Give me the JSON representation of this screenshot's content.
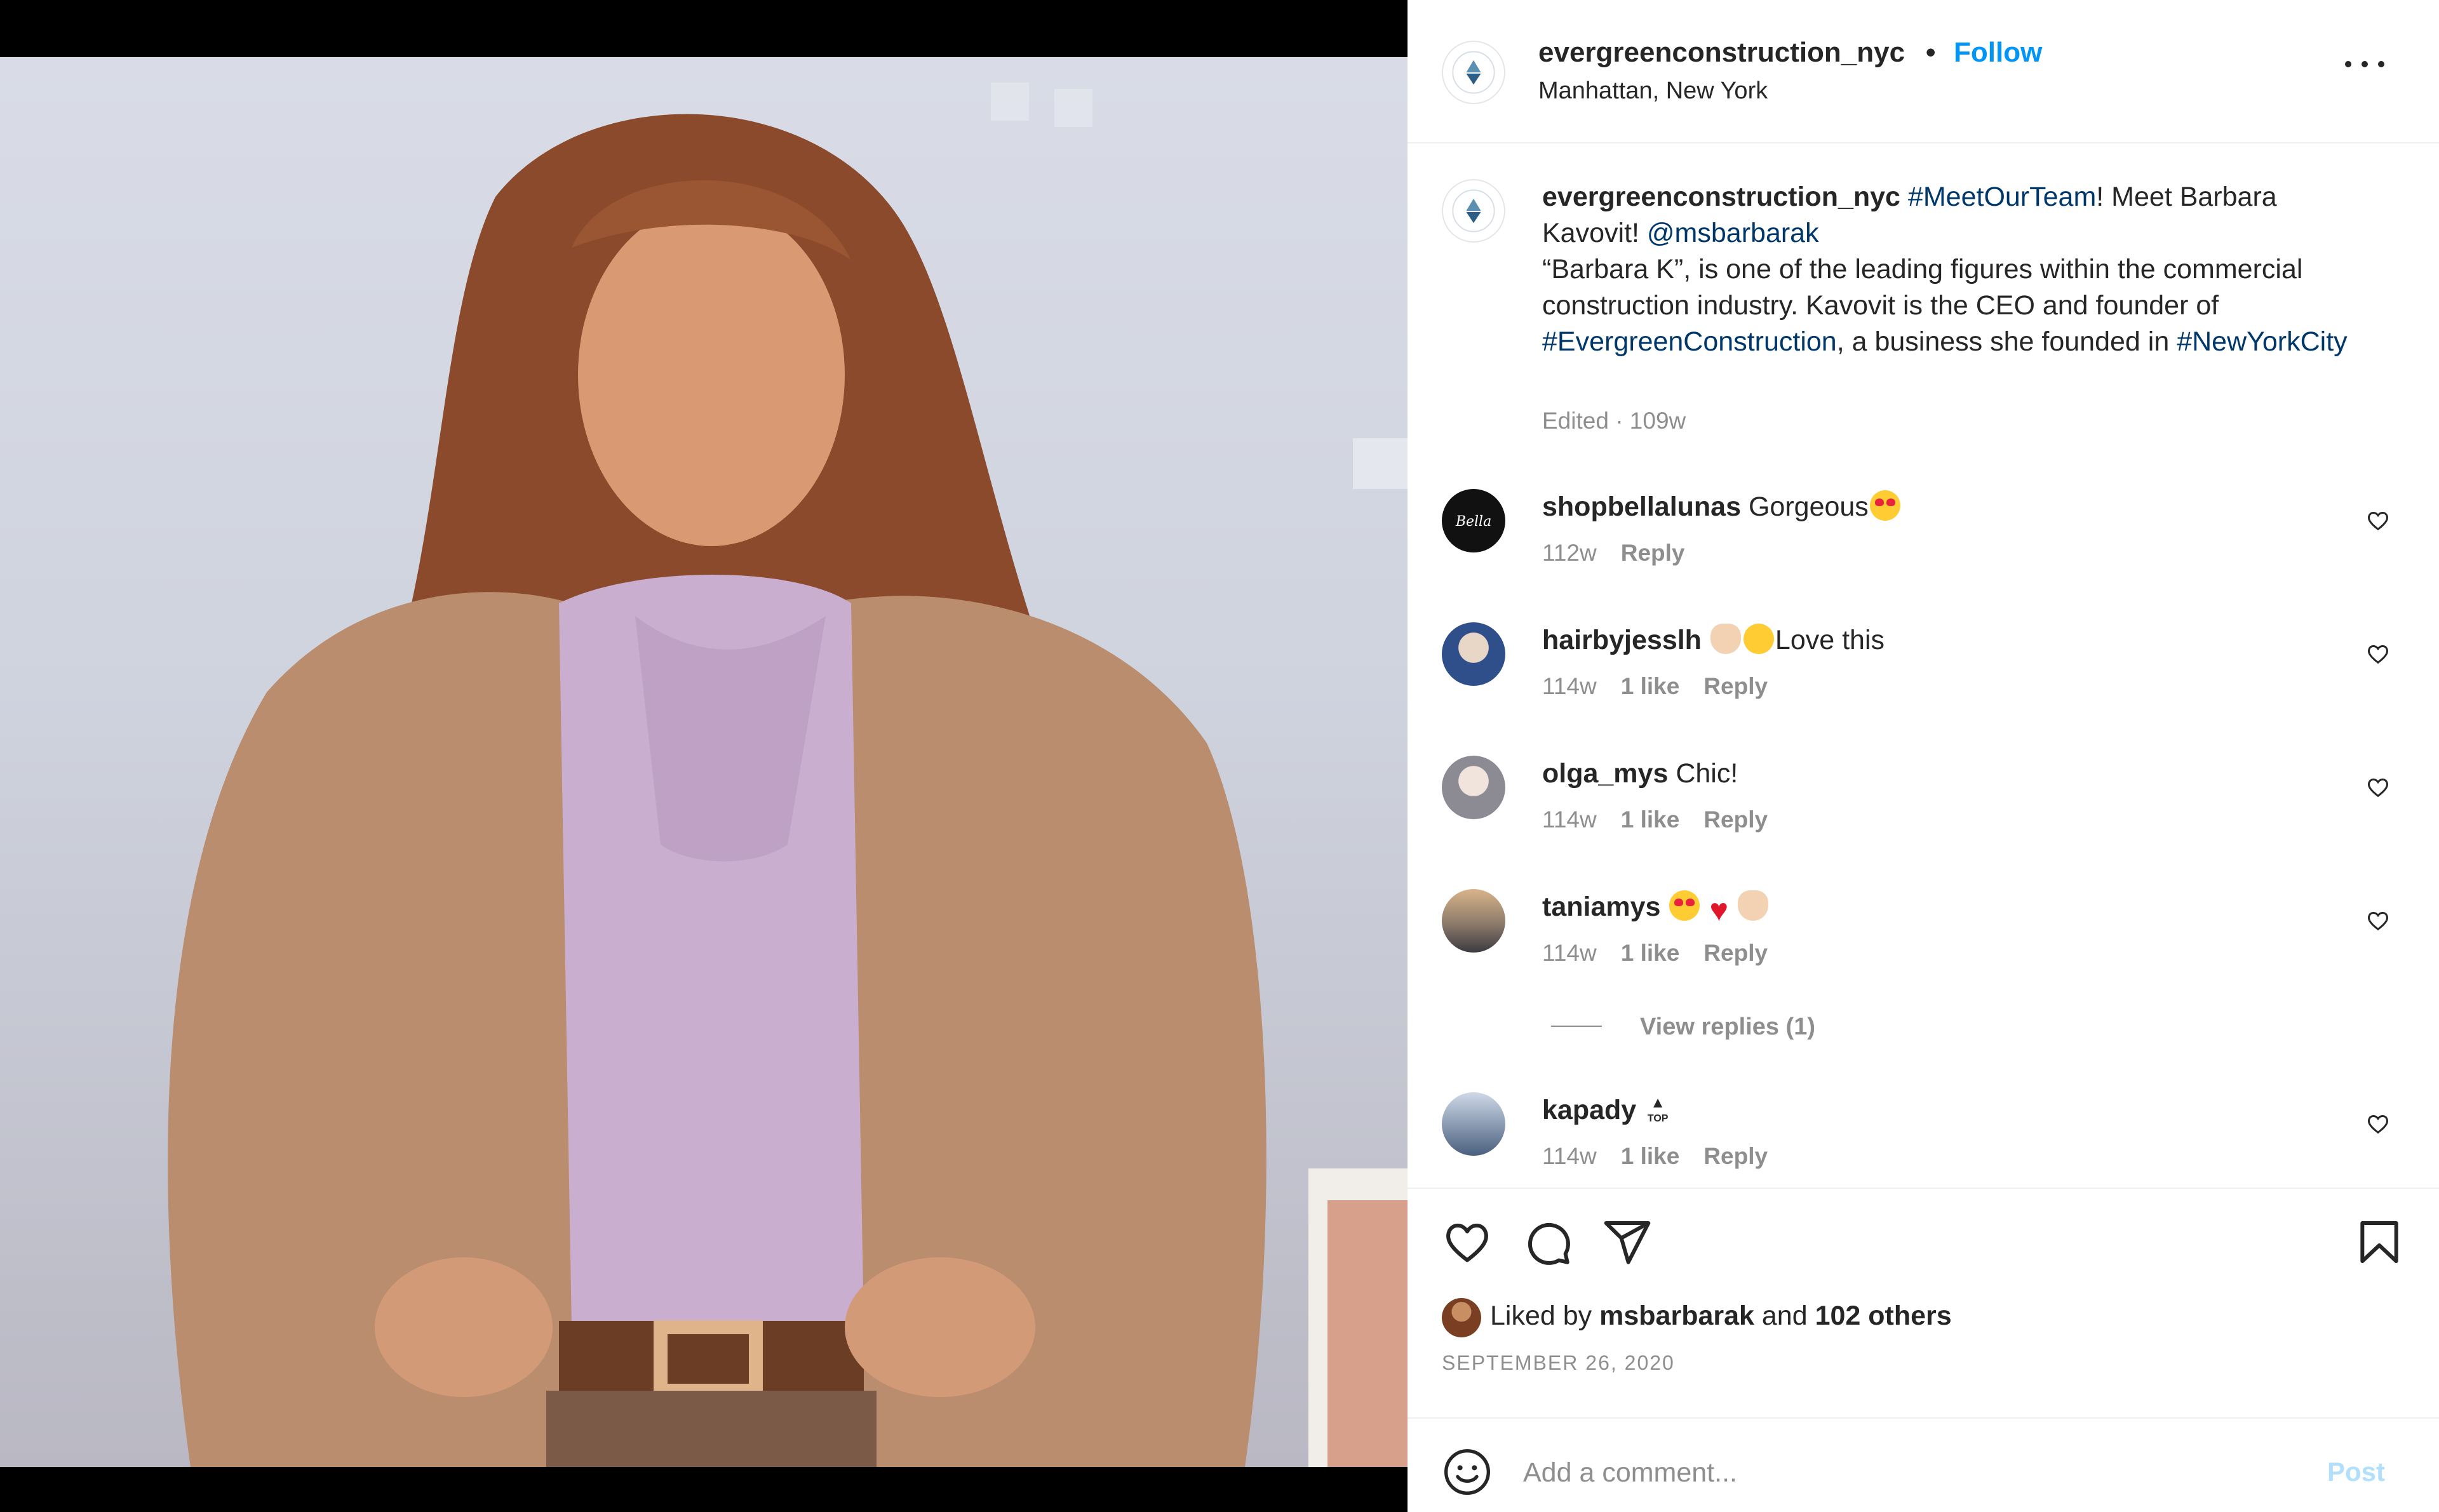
{
  "post": {
    "username": "evergreenconstruction_nyc",
    "separator": "•",
    "follow_label": "Follow",
    "location": "Manhattan, New York"
  },
  "caption": {
    "username": "evergreenconstruction_nyc",
    "tag1": "#MeetOurTeam",
    "t1": "! Meet Barbara Kavovit! ",
    "mention": "@msbarbarak",
    "t2": "“Barbara K”, is one of the leading figures within the commercial construction industry. Kavovit is the CEO and founder of ",
    "tag2": "#EvergreenConstruction",
    "t3": ", a business she founded in ",
    "tag3": "#NewYorkCity",
    "edited": "Edited · 109w"
  },
  "comments": [
    {
      "username": "shopbellalunas",
      "text": "Gorgeous",
      "age": "112w",
      "likes": "",
      "reply": "Reply"
    },
    {
      "username": "hairbyjesslh",
      "text": "Love this",
      "age": "114w",
      "likes": "1 like",
      "reply": "Reply"
    },
    {
      "username": "olga_mys",
      "text": "Chic!",
      "age": "114w",
      "likes": "1 like",
      "reply": "Reply"
    },
    {
      "username": "taniamys",
      "text": "",
      "age": "114w",
      "likes": "1 like",
      "reply": "Reply"
    },
    {
      "username": "kapady",
      "text": "",
      "age": "114w",
      "likes": "1 like",
      "reply": "Reply"
    }
  ],
  "view_replies": "View replies (1)",
  "top_label": "TOP",
  "likes": {
    "prefix": "Liked by",
    "user": "msbarbarak",
    "and": "and",
    "others": "102 others"
  },
  "date": "SEPTEMBER 26, 2020",
  "add_comment": {
    "placeholder": "Add a comment...",
    "post_label": "Post"
  },
  "colors": {
    "accent": "#0095f6",
    "hashtag": "#00376b",
    "muted": "#8e8e8e",
    "post_disabled": "#b2dffc"
  },
  "icons": [
    "more-icon",
    "heart-icon",
    "comment-icon",
    "share-icon",
    "bookmark-icon",
    "emoji-icon"
  ]
}
